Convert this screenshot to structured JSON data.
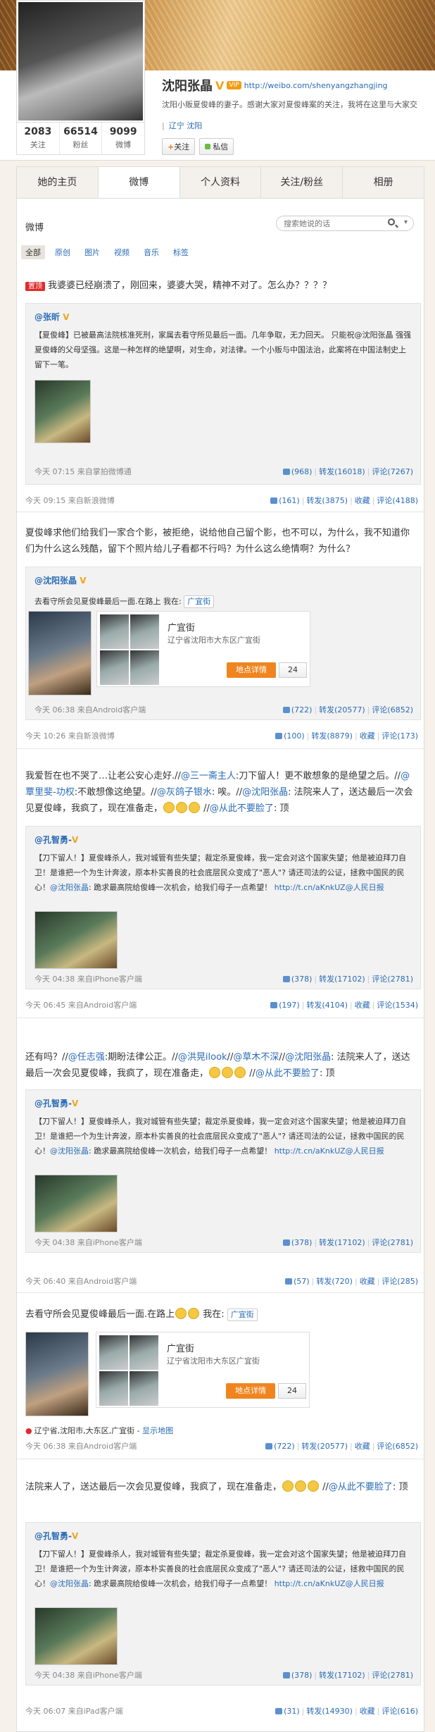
{
  "profile": {
    "name": "沈阳张晶",
    "vip_label": "VIP",
    "url": "http://weibo.com/shenyangzhangjing",
    "bio": "沈阳小贩夏俊峰的妻子。感谢大家对夏俊峰案的关注，我将在这里与大家交",
    "location_region": "辽宁",
    "location_city": "沈阳",
    "follow_label": "关注",
    "message_label": "私信",
    "stats": [
      {
        "value": "2083",
        "label": "关注"
      },
      {
        "value": "66514",
        "label": "粉丝"
      },
      {
        "value": "9099",
        "label": "微博"
      }
    ]
  },
  "tabs": [
    "她的主页",
    "微博",
    "个人资料",
    "关注/粉丝",
    "相册"
  ],
  "section_title": "微博",
  "search": {
    "placeholder": "搜索她说的话"
  },
  "filters": [
    "全部",
    "原创",
    "图片",
    "视频",
    "音乐",
    "标签"
  ],
  "posts": [
    {
      "top_tag": "置顶",
      "text": "我婆婆已经崩溃了，刚回来，婆婆大哭，精神不对了。怎么办？？？？",
      "quote_user": "@张昕",
      "quote_text": "【夏俊峰】已被最高法院核准死刑，家属去看守所见最后一面。几年争取，无力回天。 只能祝@沈阳张晶 强强 夏俊峰的父母坚强。这是一种怎样的绝望啊，对生命，对法律。一个小贩与中国法治，此案将在中国法制史上留下一笔。",
      "quote_meta": "今天 07:15  来自掌拍微博通",
      "quote_likes": "(968)",
      "quote_forwards": "转发(16018)",
      "quote_comments": "评论(7267)",
      "meta": "今天 09:15  来自新浪微博",
      "likes": "(161)",
      "forwards": "转发(3875)",
      "fav": "收藏",
      "comments": "评论(4188)"
    },
    {
      "text": "夏俊峰求他们给我们一家合个影，被拒绝，说给他自己留个影，也不可以，为什么，我不知道你们为什么这么残酷，留下个照片给儿子看都不行吗？为什么这么绝情啊？为什么？",
      "quote_user": "@沈阳张晶",
      "quote_text": "去看守所会见夏俊峰最后一面.在路上",
      "quote_here": "我在:",
      "place_chip": "广宜街",
      "place_name": "广宜街",
      "place_addr": "辽宁省沈阳市大东区广宜街",
      "place_btn": "地点详情",
      "place_cnt": "24",
      "quote_meta": "今天 06:38  来自Android客户端",
      "quote_likes": "(722)",
      "quote_forwards": "转发(20577)",
      "quote_comments": "评论(6852)",
      "meta": "今天 10:26  来自新浪微博",
      "likes": "(100)",
      "forwards": "转发(8879)",
      "fav": "收藏",
      "comments": "评论(173)"
    },
    {
      "text_a": "我爱哲在也不哭了…让老公安心走好.//",
      "text_b": "@三一斋主人",
      "text_c": ":刀下留人！更不敢想象的是绝望之后。//",
      "text_d": "@覃里斐-功权",
      "text_e": ":不敢想像这绝望。//",
      "text_f": "@灰鸽子银水",
      "text_g": ": 唉。//",
      "text_h": "@沈阳张晶",
      "text_i": ": 法院来人了，送达最后一次会见夏俊峰，我疯了，现在准备走，",
      "text_j": " //",
      "text_k": "@从此不要脸了",
      "text_l": ": 顶",
      "quote_user": "@孔智勇-",
      "quote_text_a": "【刀下留人！】夏俊峰杀人，我对城管有些失望；裁定杀夏俊峰，我一定会对这个国家失望；他是被迫拜刀自卫！是谁把一个为生计奔波，原本朴实善良的社会底层民众变成了\"恶人\"? 请还司法的公证，拯救中国民的民心！",
      "quote_text_b": "@沈阳张晶",
      "quote_text_c": ": 跪求最高院给俊峰一次机会，给我们母子一点希望！",
      "quote_link": "http://t.cn/aKnkUZ",
      "quote_src": "@人民日报",
      "quote_meta": "今天 04:38  来自iPhone客户端",
      "quote_likes": "(378)",
      "quote_forwards": "转发(17102)",
      "quote_comments": "评论(2781)",
      "meta": "今天 06:45  来自Android客户端",
      "likes": "(197)",
      "forwards": "转发(4104)",
      "fav": "收藏",
      "comments": "评论(1534)"
    },
    {
      "text_a": "还有吗？//",
      "text_b": "@任志强",
      "text_c": ":期盼法律公正。//",
      "text_d": "@洪晃ilook",
      "text_e": "//",
      "text_f": "@草木不深",
      "text_g": "//",
      "text_h": "@沈阳张晶",
      "text_i": ": 法院来人了，送达最后一次会见夏俊峰，我疯了，现在准备走，",
      "text_j": " //",
      "text_k": "@从此不要脸了",
      "text_l": ": 顶",
      "quote_user": "@孔智勇-",
      "quote_meta": "今天 04:38  来自iPhone客户端",
      "quote_likes": "(378)",
      "quote_forwards": "转发(17102)",
      "quote_comments": "评论(2781)",
      "meta": "今天 06:40  来自Android客户端",
      "likes": "(57)",
      "forwards": "转发(720)",
      "fav": "收藏",
      "comments": "评论(285)"
    },
    {
      "text": "去看守所会见夏俊峰最后一面.在路上",
      "here": "我在:",
      "place_chip": "广宜街",
      "place_name": "广宜街",
      "place_addr": "辽宁省沈阳市大东区广宜街",
      "place_btn": "地点详情",
      "place_cnt": "24",
      "geo": "辽宁省,沈阳市,大东区,广宜街",
      "geo_link": "显示地图",
      "meta": "今天 06:38  来自Android客户端",
      "likes": "(722)",
      "forwards": "转发(20577)",
      "fav": "收藏",
      "comments": "评论(6852)"
    },
    {
      "text_a": "法院来人了，送达最后一次会见夏俊峰，我疯了，现在准备走，",
      "text_b": " //",
      "text_c": "@从此不要脸了",
      "text_d": ": 顶",
      "quote_user": "@孔智勇-",
      "quote_meta": "今天 04:38  来自iPhone客户端",
      "quote_likes": "(378)",
      "quote_forwards": "转发(17102)",
      "quote_comments": "评论(2781)",
      "meta": "今天 06:07  来自iPad客户端",
      "likes": "(31)",
      "forwards": "转发(14930)",
      "fav": "收藏",
      "comments": "评论(616)"
    }
  ]
}
